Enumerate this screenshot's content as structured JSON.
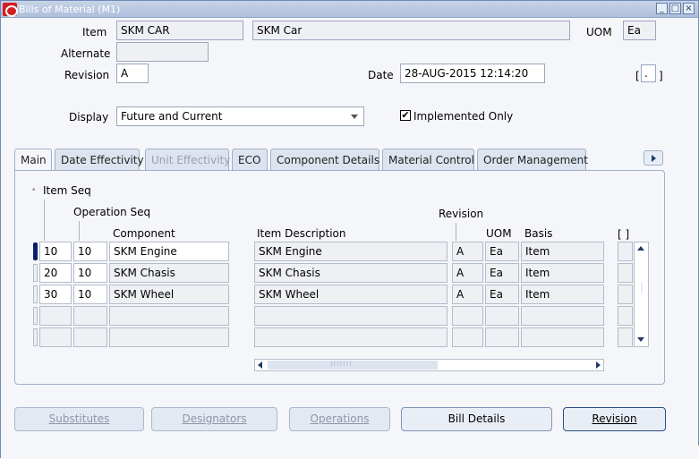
{
  "window": {
    "title": "Bills of Material (M1)",
    "controls": [
      "_",
      "□",
      "×"
    ]
  },
  "header": {
    "item_label": "Item",
    "item_value": "SKM CAR",
    "item_description": "SKM Car",
    "uom_label": "UOM",
    "uom_value": "Ea",
    "alternate_label": "Alternate",
    "alternate_value": "",
    "revision_label": "Revision",
    "revision_value": "A",
    "date_label": "Date",
    "date_value": "28-AUG-2015 12:14:20",
    "flex_open": "[",
    "flex_value": ".",
    "flex_close": "]",
    "display_label": "Display",
    "display_value": "Future and Current",
    "implemented_only_label": "Implemented Only",
    "implemented_only_checked": true
  },
  "tabs": [
    {
      "label": "Main",
      "state": "active"
    },
    {
      "label": "Date Effectivity",
      "state": "normal"
    },
    {
      "label": "Unit Effectivity",
      "state": "disabled"
    },
    {
      "label": "ECO",
      "state": "normal"
    },
    {
      "label": "Component Details",
      "state": "normal"
    },
    {
      "label": "Material Control",
      "state": "normal"
    },
    {
      "label": "Order Management",
      "state": "normal"
    }
  ],
  "grid": {
    "headers": {
      "item_seq": "Item Seq",
      "operation_seq": "Operation Seq",
      "component": "Component",
      "item_description": "Item Description",
      "revision": "Revision",
      "uom": "UOM",
      "basis": "Basis",
      "flex": "[ ]"
    },
    "rows": [
      {
        "item_seq": "10",
        "operation_seq": "10",
        "component": "SKM Engine",
        "description": "SKM Engine",
        "revision": "A",
        "uom": "Ea",
        "basis": "Item"
      },
      {
        "item_seq": "20",
        "operation_seq": "10",
        "component": "SKM Chasis",
        "description": "SKM Chasis",
        "revision": "A",
        "uom": "Ea",
        "basis": "Item"
      },
      {
        "item_seq": "30",
        "operation_seq": "10",
        "component": "SKM Wheel",
        "description": "SKM Wheel",
        "revision": "A",
        "uom": "Ea",
        "basis": "Item"
      },
      {
        "item_seq": "",
        "operation_seq": "",
        "component": "",
        "description": "",
        "revision": "",
        "uom": "",
        "basis": ""
      },
      {
        "item_seq": "",
        "operation_seq": "",
        "component": "",
        "description": "",
        "revision": "",
        "uom": "",
        "basis": ""
      }
    ]
  },
  "buttons": {
    "substitutes": "Substitutes",
    "designators": "Designators",
    "operations": "Operations",
    "bill_details": "Bill Details",
    "revision": "Revision"
  },
  "colors": {
    "title_bar": "#aebfdc",
    "window_bg": "#f5f6f9",
    "tab_bg": "#dde4ef",
    "active_row_marker": "#0a1f6e",
    "logo_red": "#d21f1f"
  }
}
